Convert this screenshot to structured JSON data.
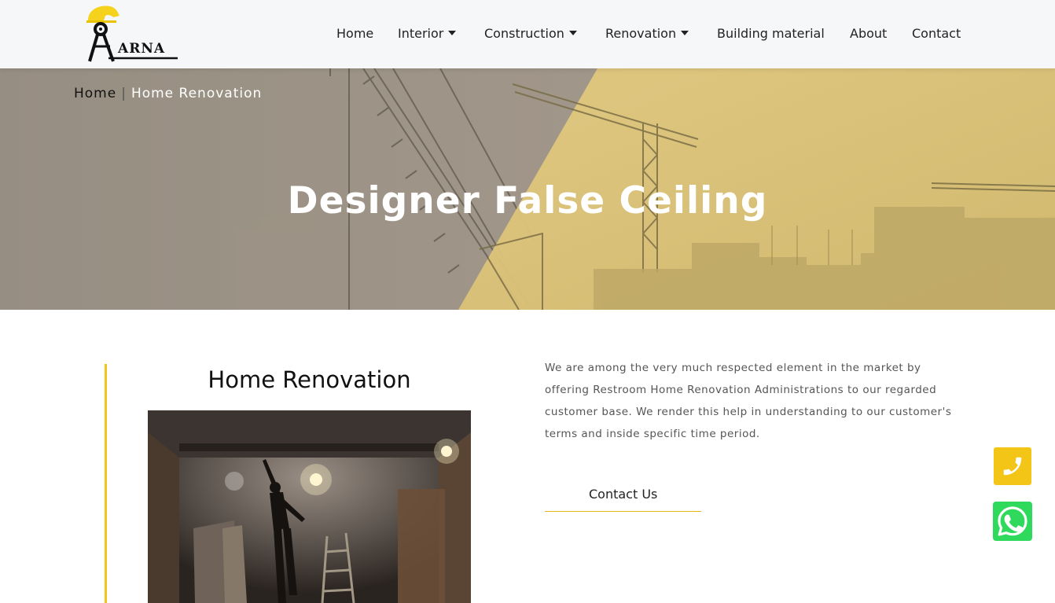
{
  "brand": {
    "name": "ARNA",
    "colors": {
      "accent": "#f2c516",
      "whatsapp": "#2fd95b"
    }
  },
  "nav": {
    "items": [
      {
        "label": "Home",
        "dropdown": false
      },
      {
        "label": "Interior",
        "dropdown": true
      },
      {
        "label": "Construction",
        "dropdown": true
      },
      {
        "label": "Renovation",
        "dropdown": true
      },
      {
        "label": "Building material",
        "dropdown": false
      },
      {
        "label": "About",
        "dropdown": false
      },
      {
        "label": "Contact",
        "dropdown": false
      }
    ]
  },
  "breadcrumb": {
    "home": "Home",
    "separator": "|",
    "current": "Home Renovation"
  },
  "hero": {
    "title": "Designer False Ceiling"
  },
  "content": {
    "title": "Home Renovation",
    "description": "We are among the very much respected element in the market by offering Restroom Home Renovation Administrations to our regarded customer base. We render this help in understanding to our customer's terms and inside specific time period.",
    "cta": "Contact Us"
  },
  "floating": {
    "phone_icon": "phone-icon",
    "whatsapp_icon": "whatsapp-icon"
  }
}
